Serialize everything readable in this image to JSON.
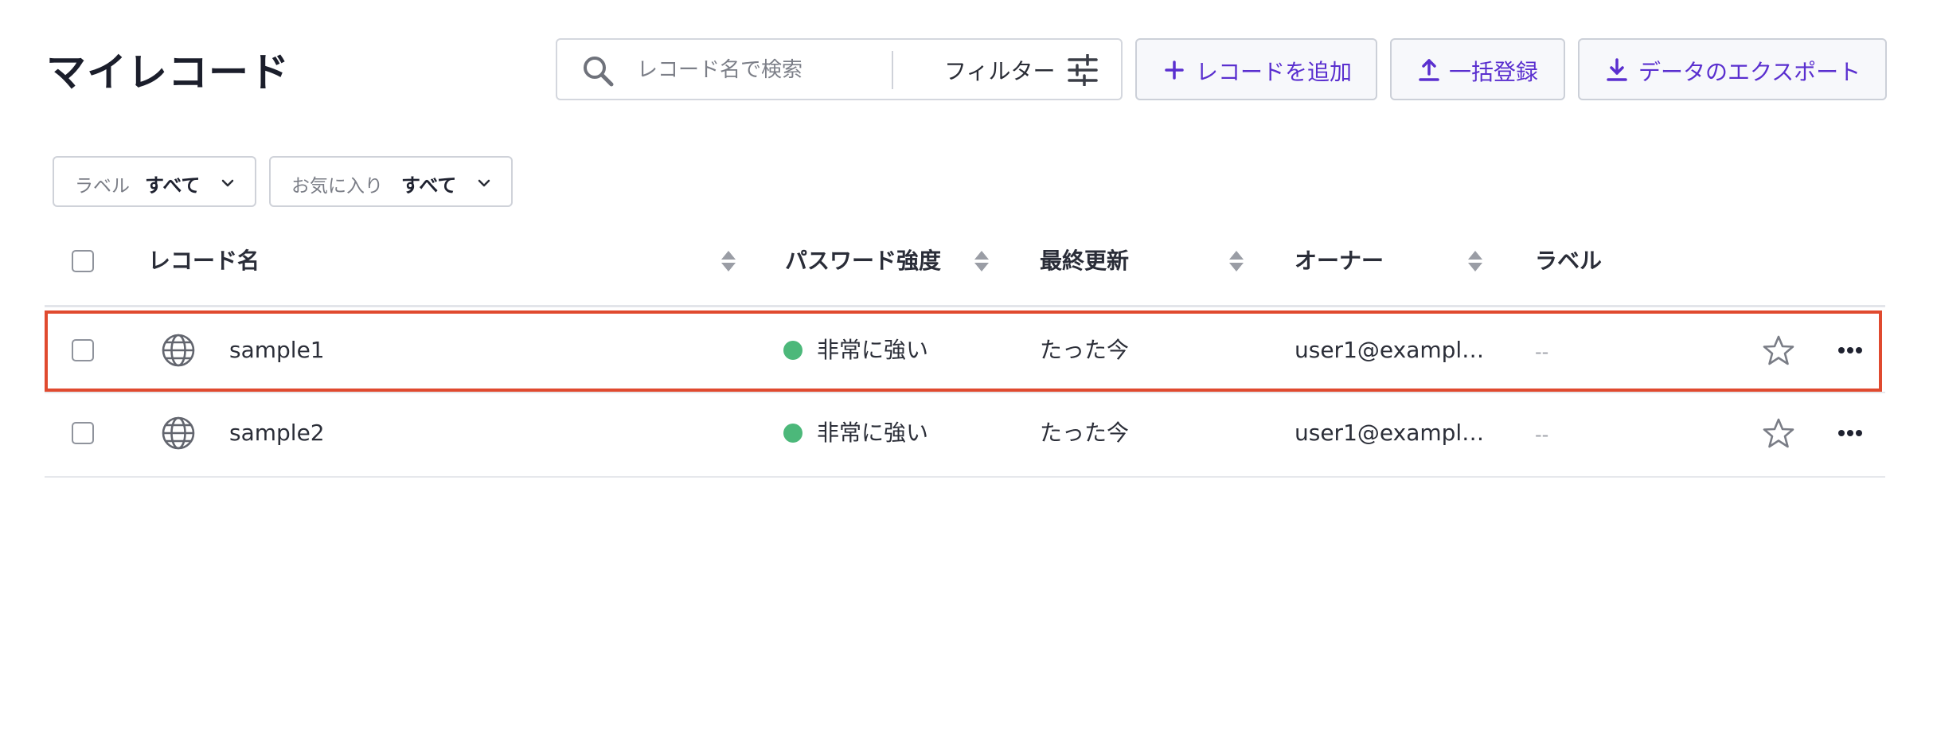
{
  "page": {
    "title": "マイレコード"
  },
  "toolbar": {
    "search_placeholder": "レコード名で検索",
    "filter_label": "フィルター",
    "add_label": "レコードを追加",
    "bulk_label": "一括登録",
    "export_label": "データのエクスポート"
  },
  "filters": {
    "label": {
      "key": "ラベル",
      "value": "すべて"
    },
    "favorite": {
      "key": "お気に入り",
      "value": "すべて"
    }
  },
  "table": {
    "columns": [
      "レコード名",
      "パスワード強度",
      "最終更新",
      "オーナー",
      "ラベル"
    ],
    "rows": [
      {
        "name": "sample1",
        "strength": "非常に強い",
        "updated": "たった今",
        "owner": "user1@exampl…",
        "label": "--",
        "highlighted": true
      },
      {
        "name": "sample2",
        "strength": "非常に強い",
        "updated": "たった今",
        "owner": "user1@exampl…",
        "label": "--",
        "highlighted": false
      }
    ]
  },
  "colors": {
    "accent": "#5a2fcf",
    "strength_strong": "#4cb87a",
    "highlight": "#e04a2f"
  }
}
